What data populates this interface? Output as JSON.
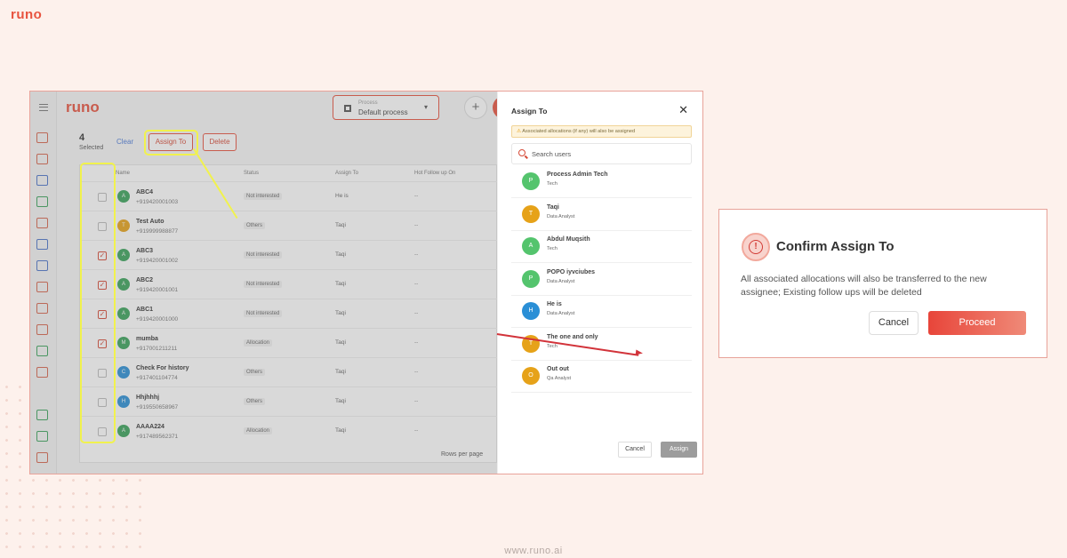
{
  "brand": {
    "logo": "runo",
    "footer_url": "www.runo.ai"
  },
  "app": {
    "logo": "runo",
    "process_label": "Process",
    "process_value": "Default process",
    "selected_count": "4",
    "selected_label": "Selected",
    "clear_label": "Clear",
    "assign_to_label": "Assign To",
    "delete_label": "Delete",
    "columns": [
      "Name",
      "Status",
      "Assign To",
      "Hot Follow up On"
    ],
    "rows_per_page_label": "Rows per page",
    "rows": [
      {
        "avatar": "A",
        "avatar_color": "#3aa35b",
        "name": "ABC4",
        "phone": "+919420001003",
        "status": "Not interested",
        "assign": "He is",
        "follow": "--",
        "checked": false
      },
      {
        "avatar": "T",
        "avatar_color": "#e6a219",
        "name": "Test Auto",
        "phone": "+919999988877",
        "status": "Others",
        "assign": "Taqi",
        "follow": "--",
        "checked": false
      },
      {
        "avatar": "A",
        "avatar_color": "#3aa35b",
        "name": "ABC3",
        "phone": "+919420001002",
        "status": "Not interested",
        "assign": "Taqi",
        "follow": "--",
        "checked": true
      },
      {
        "avatar": "A",
        "avatar_color": "#3aa35b",
        "name": "ABC2",
        "phone": "+919420001001",
        "status": "Not interested",
        "assign": "Taqi",
        "follow": "--",
        "checked": true
      },
      {
        "avatar": "A",
        "avatar_color": "#3aa35b",
        "name": "ABC1",
        "phone": "+919420001000",
        "status": "Not interested",
        "assign": "Taqi",
        "follow": "--",
        "checked": true
      },
      {
        "avatar": "M",
        "avatar_color": "#3aa35b",
        "name": "mumba",
        "phone": "+917001211211",
        "status": "Allocation",
        "assign": "Taqi",
        "follow": "--",
        "checked": true
      },
      {
        "avatar": "C",
        "avatar_color": "#2a8fd6",
        "name": "Check For history",
        "phone": "+917401104774",
        "status": "Others",
        "assign": "Taqi",
        "follow": "--",
        "checked": false
      },
      {
        "avatar": "H",
        "avatar_color": "#2a8fd6",
        "name": "Hhjhhhj",
        "phone": "+919550658967",
        "status": "Others",
        "assign": "Taqi",
        "follow": "--",
        "checked": false
      },
      {
        "avatar": "A",
        "avatar_color": "#3aa35b",
        "name": "AAAA224",
        "phone": "+917489562371",
        "status": "Allocation",
        "assign": "Taqi",
        "follow": "--",
        "checked": false
      }
    ]
  },
  "drawer": {
    "title": "Assign To",
    "warning": "Associated allocations (if any) will also be assigned",
    "search_placeholder": "Search users",
    "users": [
      {
        "initial": "P",
        "color": "#54c46d",
        "name": "Process Admin Tech",
        "role": "Tech"
      },
      {
        "initial": "T",
        "color": "#e6a219",
        "name": "Taqi",
        "role": "Data Analyst"
      },
      {
        "initial": "A",
        "color": "#54c46d",
        "name": "Abdul Muqsith",
        "role": "Tech"
      },
      {
        "initial": "P",
        "color": "#54c46d",
        "name": "POPO iyvciubes",
        "role": "Data Analyst"
      },
      {
        "initial": "H",
        "color": "#2a8fd6",
        "name": "He is",
        "role": "Data Analyst"
      },
      {
        "initial": "T",
        "color": "#e6a219",
        "name": "The one and only",
        "role": "Tech"
      },
      {
        "initial": "O",
        "color": "#e6a219",
        "name": "Out out",
        "role": "Qa Analyst"
      }
    ],
    "cancel_label": "Cancel",
    "assign_label": "Assign"
  },
  "confirm": {
    "title": "Confirm Assign To",
    "message": "All associated allocations will also be transferred to the new assignee; Existing follow ups will be deleted",
    "cancel_label": "Cancel",
    "proceed_label": "Proceed"
  },
  "colors": {
    "accent": "#e8533f",
    "highlight": "#f1f24d",
    "background": "#fdf1ec"
  }
}
